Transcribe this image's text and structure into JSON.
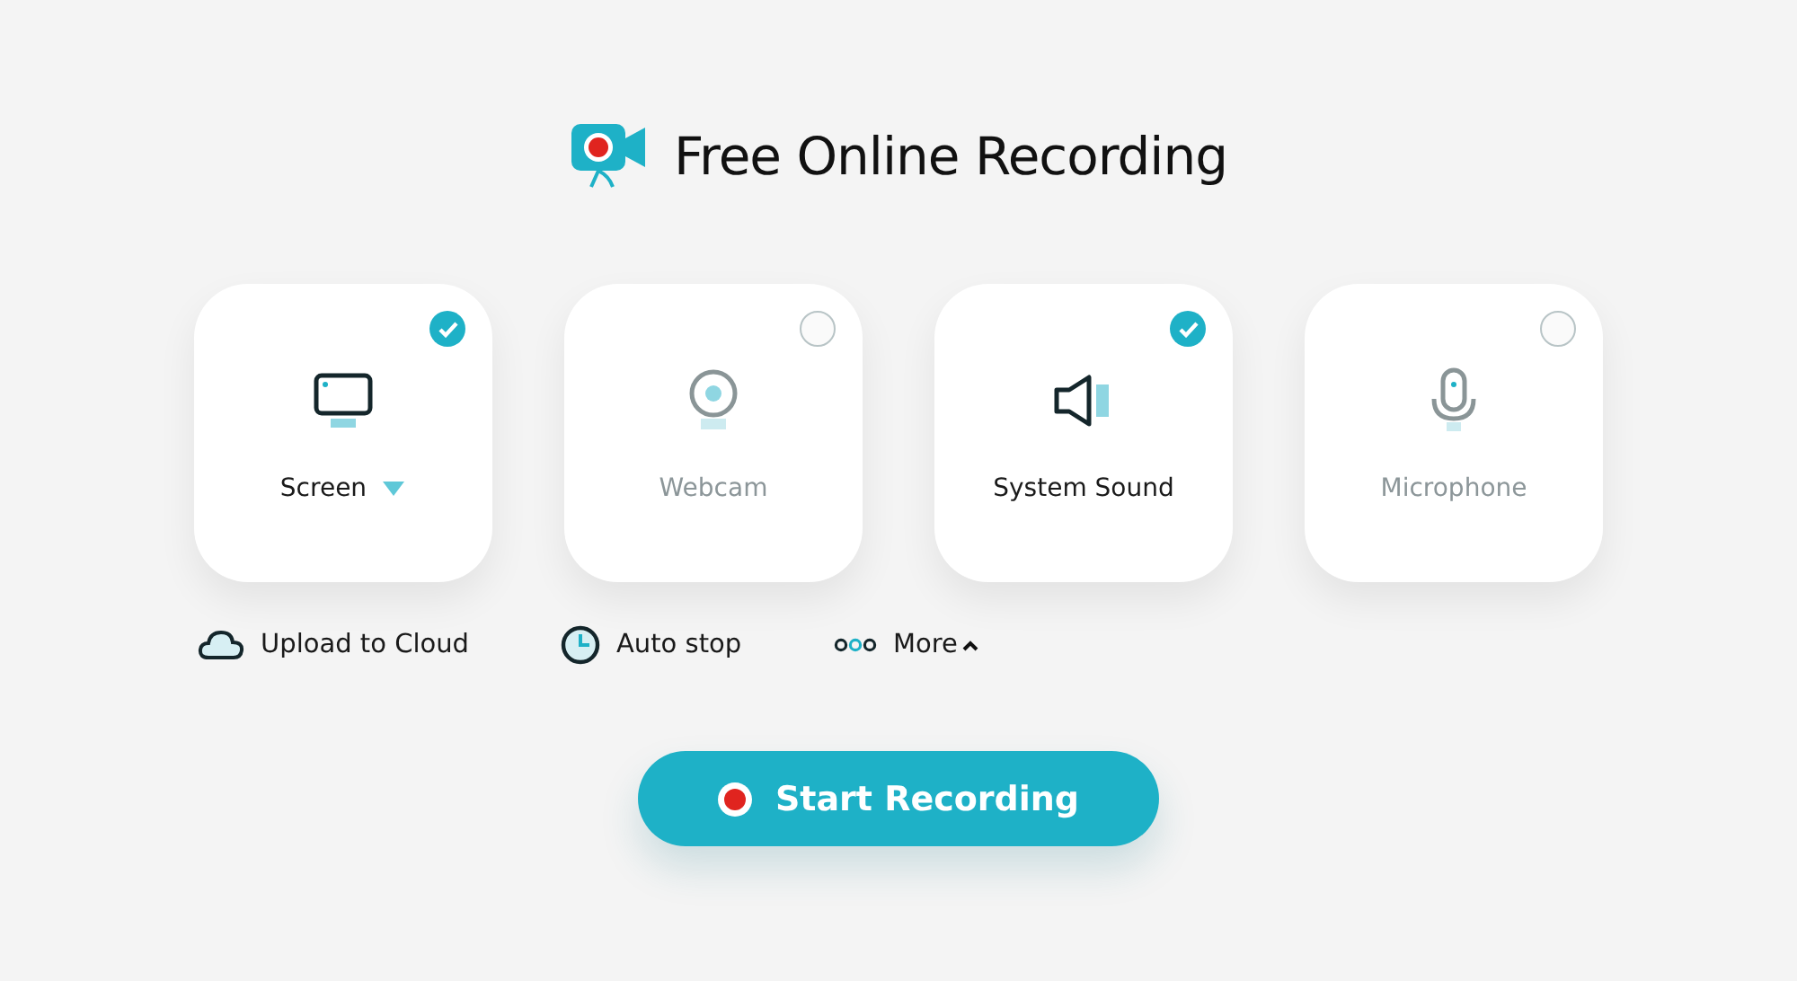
{
  "title": "Free Online Recording",
  "sources": [
    {
      "kind": "screen",
      "label": "Screen",
      "checked": true,
      "has_dropdown": true
    },
    {
      "kind": "webcam",
      "label": "Webcam",
      "checked": false,
      "has_dropdown": false
    },
    {
      "kind": "sound",
      "label": "System Sound",
      "checked": true,
      "has_dropdown": false
    },
    {
      "kind": "microphone",
      "label": "Microphone",
      "checked": false,
      "has_dropdown": false
    }
  ],
  "options": [
    {
      "kind": "cloud",
      "label": "Upload to Cloud"
    },
    {
      "kind": "clock",
      "label": "Auto stop"
    },
    {
      "kind": "more",
      "label": "More",
      "expanded": true
    }
  ],
  "start_button": "Start Recording"
}
